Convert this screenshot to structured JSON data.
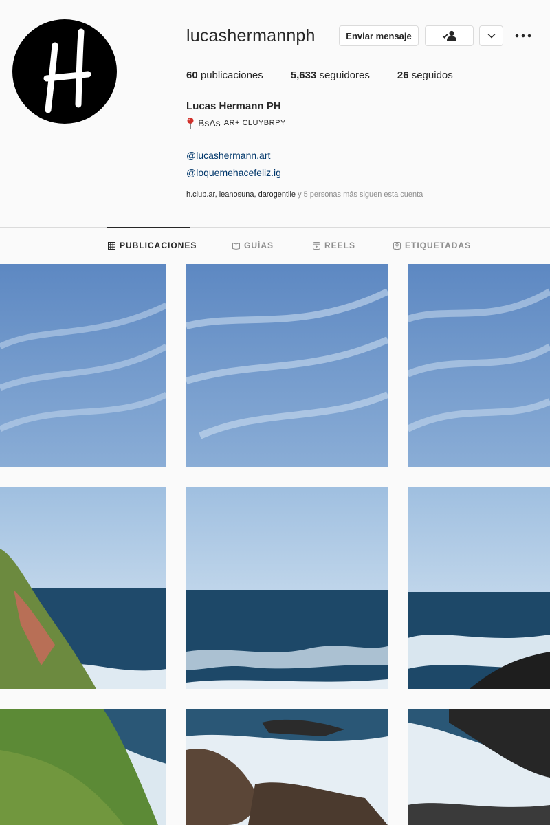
{
  "profile": {
    "username": "lucashermannph",
    "message_button": "Enviar mensaje",
    "follow_icon": "person-check-icon",
    "stats": {
      "posts": "60",
      "posts_label": " publicaciones",
      "followers": "5,633",
      "followers_label": " seguidores",
      "following": "26",
      "following_label": " seguidos"
    },
    "full_name": "Lucas Hermann PH",
    "bio_location": "BsAs",
    "bio_tags": "AR+ CLUYBRPY",
    "bio_line": "——————————————",
    "links": [
      "@lucashermann.art",
      "@loquemehacefeliz.ig"
    ],
    "followed_by_names": "h.club.ar, leanosuna, darogentile",
    "followed_by_suffix": " y 5 personas más siguen esta cuenta"
  },
  "tabs": [
    {
      "label": "PUBLICACIONES",
      "icon": "grid-icon",
      "active": true
    },
    {
      "label": "GUÍAS",
      "icon": "guide-icon",
      "active": false
    },
    {
      "label": "REELS",
      "icon": "reels-icon",
      "active": false
    },
    {
      "label": "ETIQUETADAS",
      "icon": "tag-icon",
      "active": false
    }
  ],
  "grid": {
    "posts": [
      "sky",
      "sky",
      "sky",
      "sea-cliff-left",
      "sea-horizon",
      "sea-rocks-right",
      "cliff-grass",
      "rocks-surf",
      "rocky-shore"
    ]
  },
  "colors": {
    "sky": "#6f95c6",
    "sea": "#1f4a6b",
    "link": "#00376b",
    "text": "#262626",
    "muted": "#8e8e8e",
    "border": "#dbdbdb"
  }
}
